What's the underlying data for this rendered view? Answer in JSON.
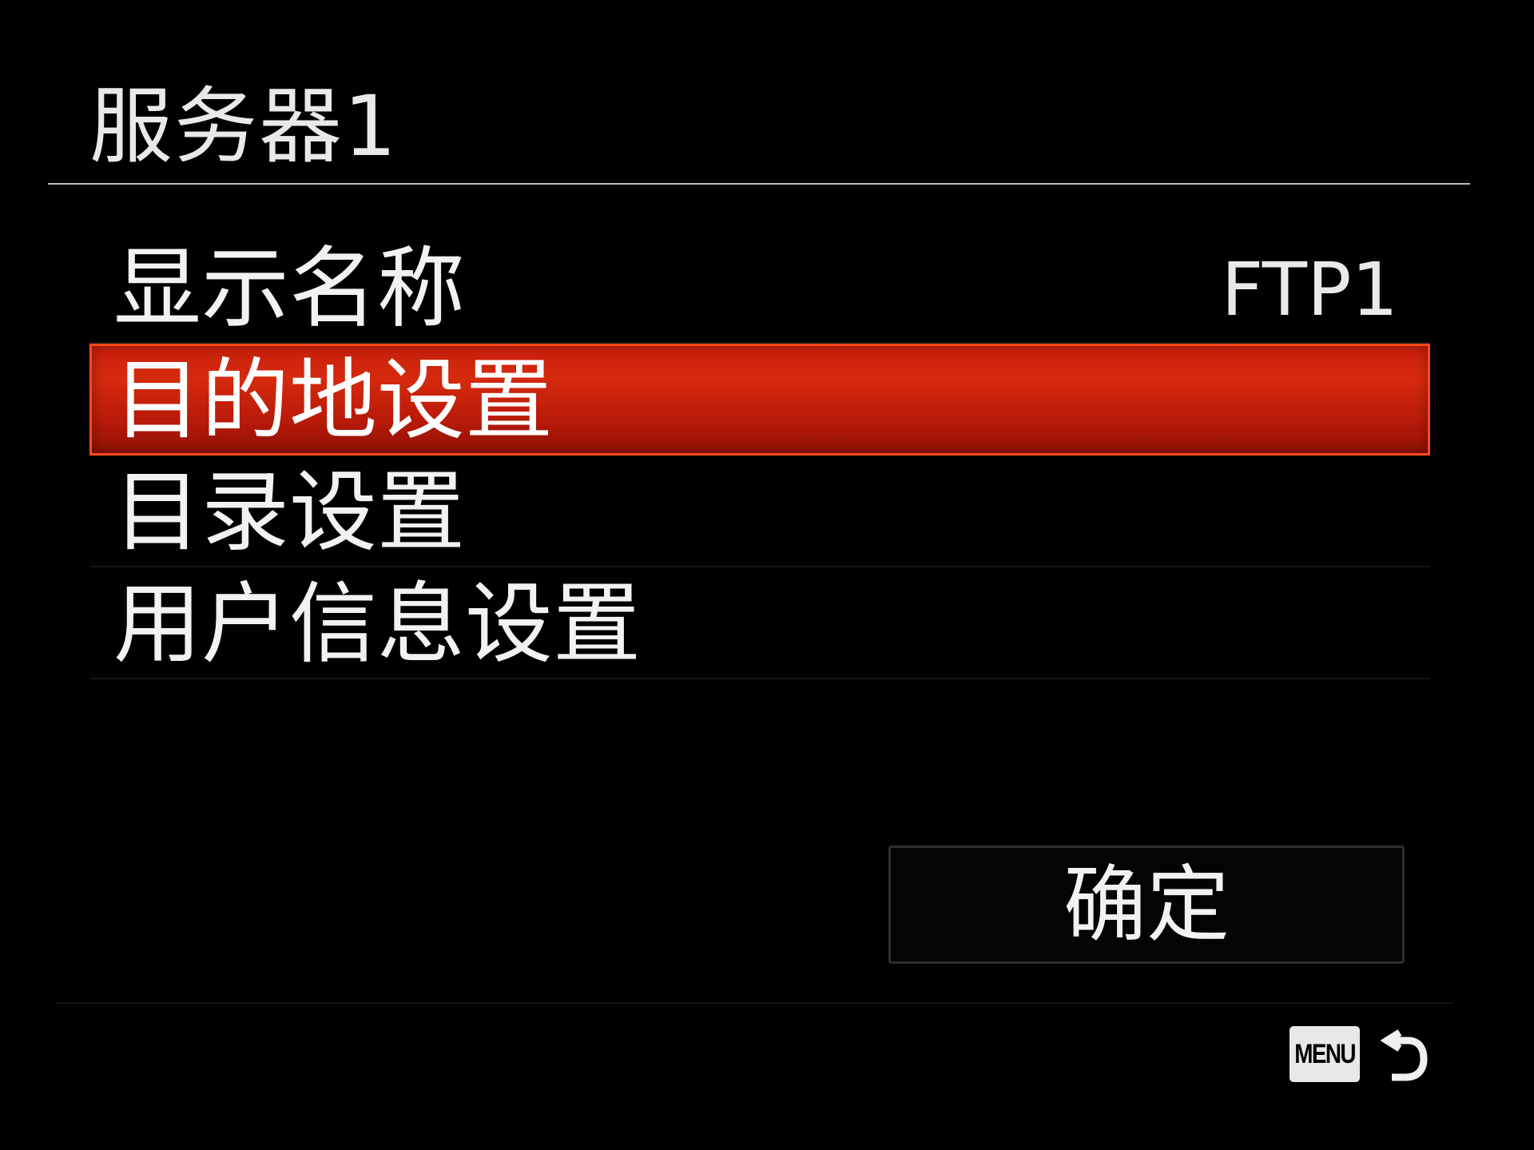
{
  "header": {
    "title": "服务器1"
  },
  "menu": {
    "items": [
      {
        "label": "显示名称",
        "value": "FTP1",
        "selected": false
      },
      {
        "label": "目的地设置",
        "value": "",
        "selected": true
      },
      {
        "label": "目录设置",
        "value": "",
        "selected": false
      },
      {
        "label": "用户信息设置",
        "value": "",
        "selected": false
      }
    ]
  },
  "actions": {
    "confirm_label": "确定"
  },
  "footer": {
    "menu_key_label": "MENU",
    "back_icon": "return-arrow-icon"
  },
  "colors": {
    "background": "#000000",
    "highlight": "#c8200c",
    "highlight_border": "#ff4a1a",
    "text": "#f2f2f2"
  }
}
